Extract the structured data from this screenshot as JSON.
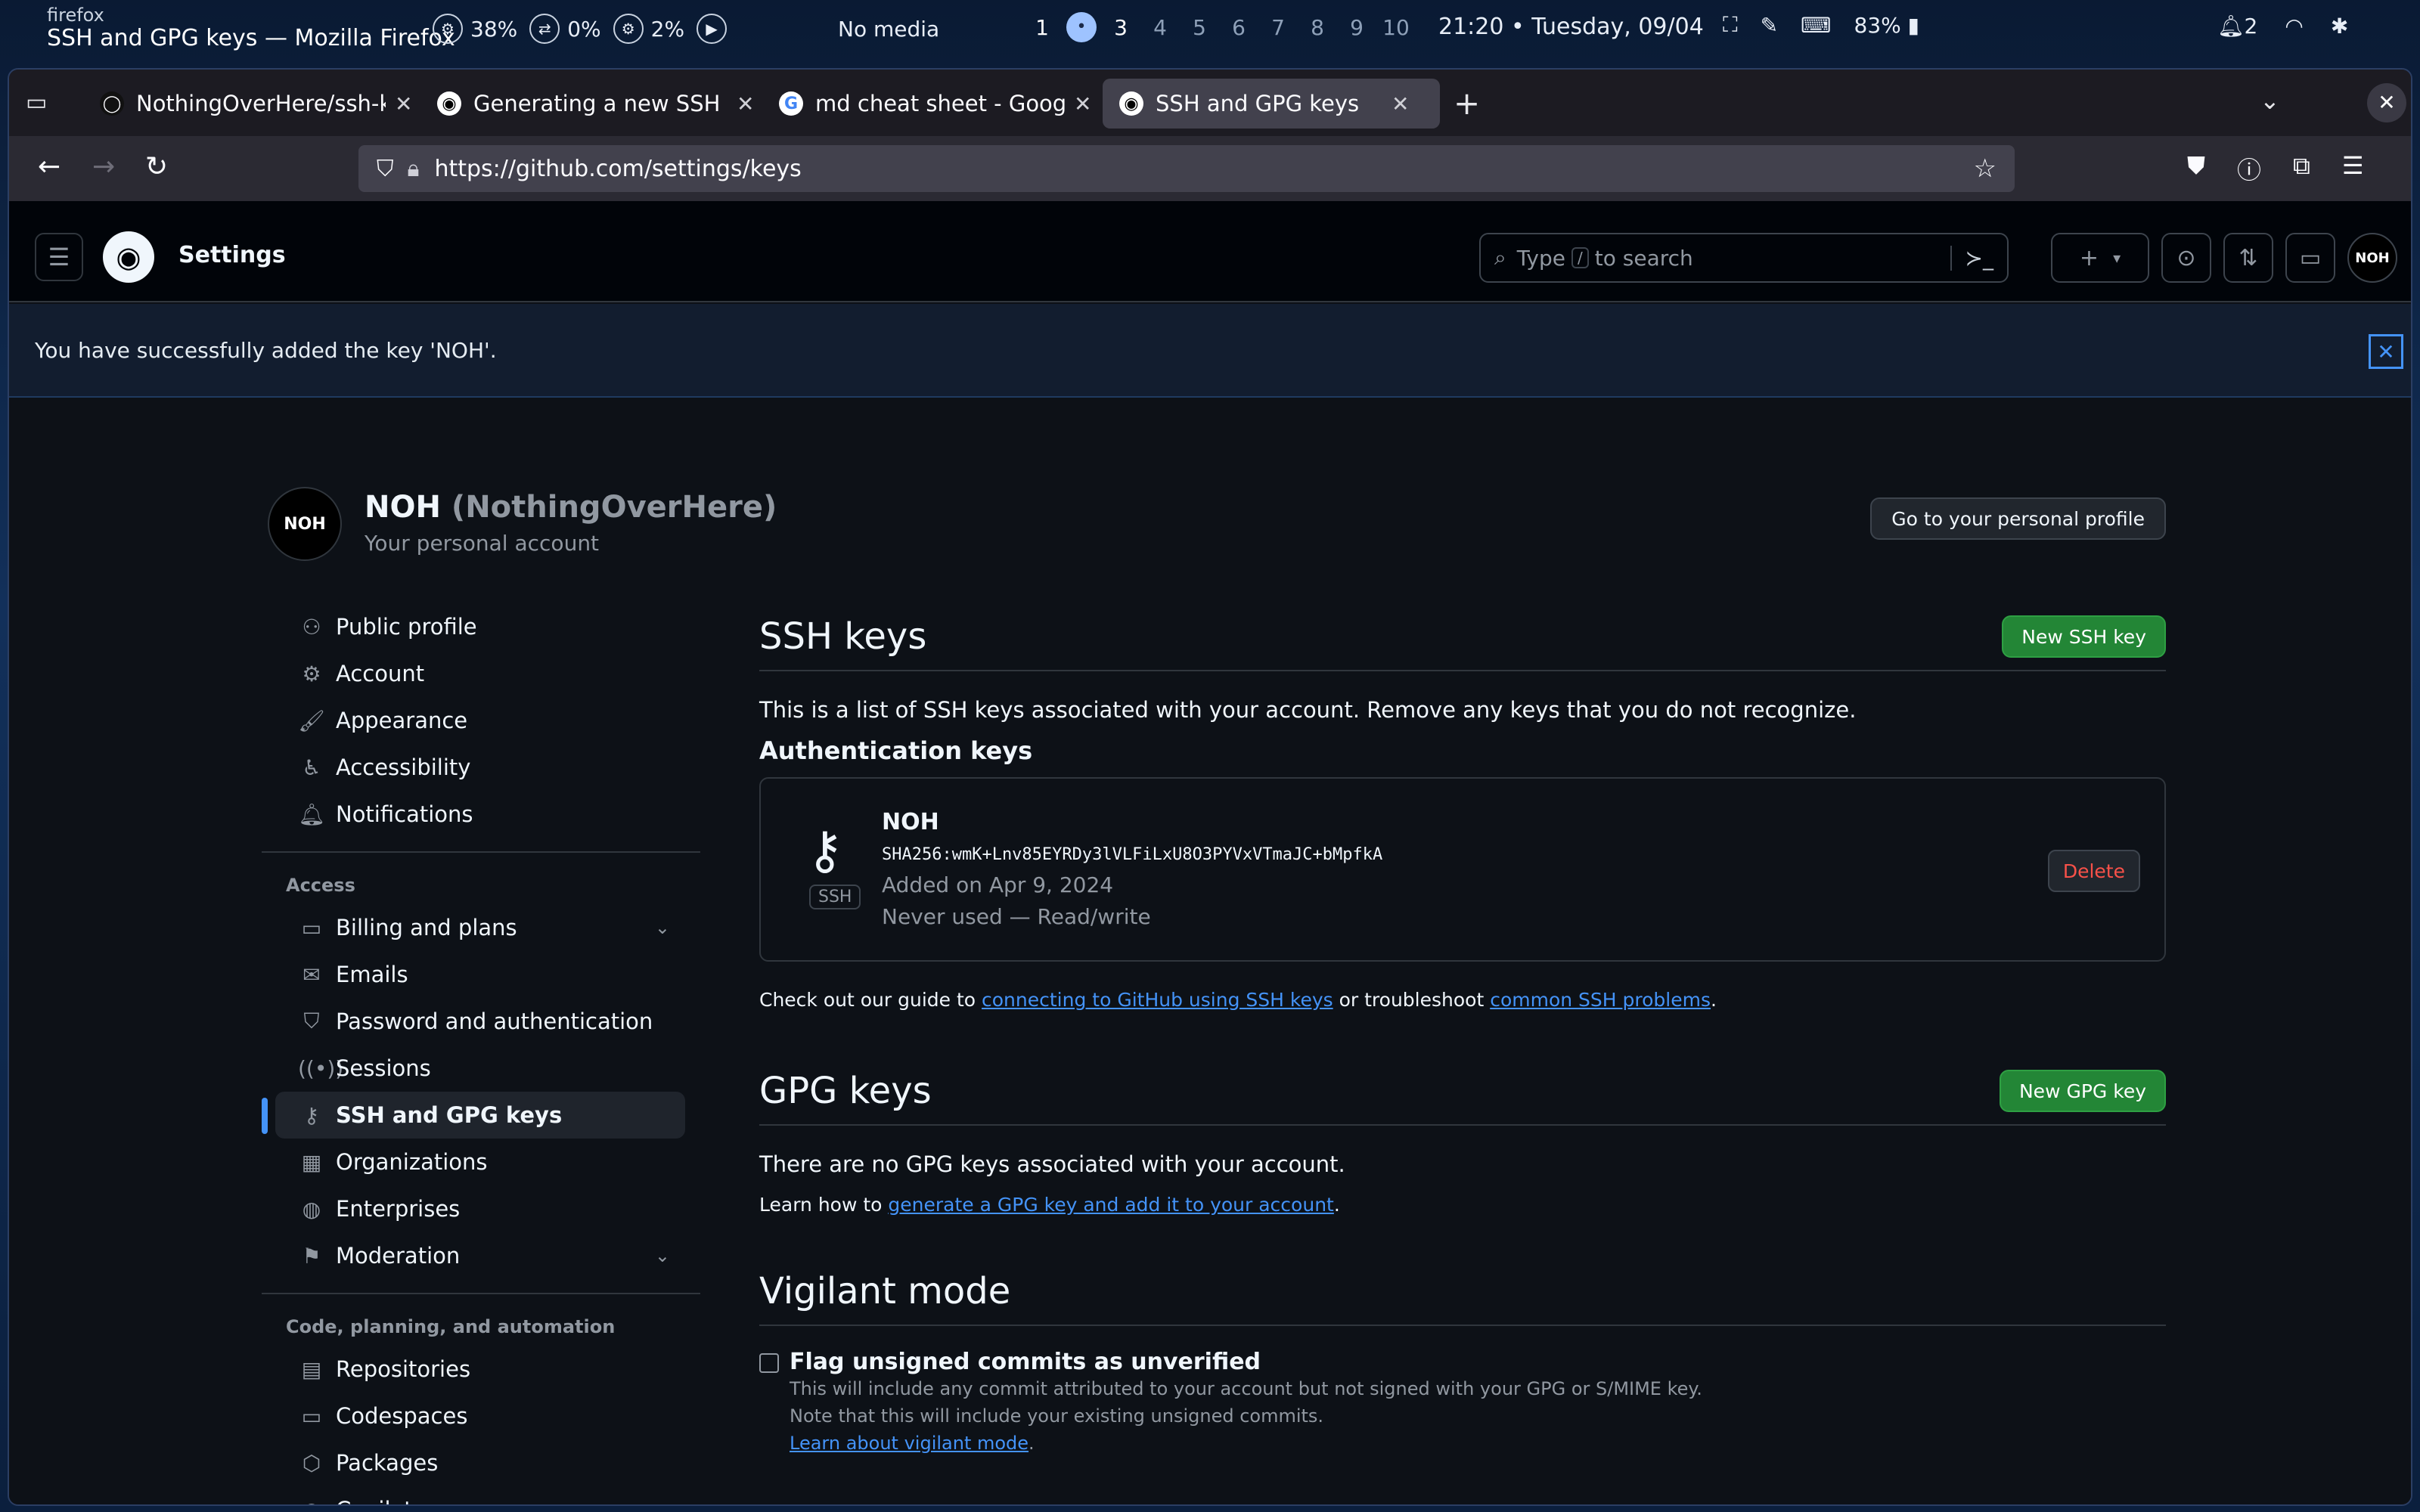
{
  "system": {
    "app_name": "firefox",
    "window_title": "SSH and GPG keys — Mozilla Firefox",
    "stats": [
      {
        "icon": "cpu-icon",
        "value": "38%"
      },
      {
        "icon": "swap-icon",
        "value": "0%"
      },
      {
        "icon": "memory-icon",
        "value": "2%"
      }
    ],
    "media": "No media",
    "workspaces": [
      "1",
      "•",
      "3",
      "4",
      "5",
      "6",
      "7",
      "8",
      "9",
      "10"
    ],
    "active_workspace": 1,
    "clock": "21:20 • Tuesday, 09/04",
    "battery": "83%",
    "notifications": "2"
  },
  "browser": {
    "tabs": [
      {
        "title": "NothingOverHere/ssh-k",
        "favicon": "github-icon",
        "active": false
      },
      {
        "title": "Generating a new SSH k",
        "favicon": "github-icon",
        "active": false
      },
      {
        "title": "md cheat sheet - Google",
        "favicon": "google-icon",
        "active": false
      },
      {
        "title": "SSH and GPG keys",
        "favicon": "github-icon",
        "active": true
      }
    ],
    "url": "https://github.com/settings/keys"
  },
  "github": {
    "context": "Settings",
    "search_placeholder_pre": "Type",
    "search_kbd": "/",
    "search_placeholder_post": "to search",
    "avatar_text": "NOH",
    "flash_message": "You have successfully added the key 'NOH'.",
    "profile": {
      "avatar_text": "NOH",
      "name": "NOH",
      "login": "(NothingOverHere)",
      "subtitle": "Your personal account",
      "profile_button": "Go to your personal profile"
    },
    "sidebar": {
      "items_top": [
        {
          "label": "Public profile",
          "icon": "person-icon"
        },
        {
          "label": "Account",
          "icon": "gear-icon"
        },
        {
          "label": "Appearance",
          "icon": "paintbrush-icon"
        },
        {
          "label": "Accessibility",
          "icon": "accessibility-icon"
        },
        {
          "label": "Notifications",
          "icon": "bell-icon"
        }
      ],
      "access_heading": "Access",
      "items_access": [
        {
          "label": "Billing and plans",
          "icon": "credit-card-icon"
        },
        {
          "label": "Emails",
          "icon": "mail-icon"
        },
        {
          "label": "Password and authentication",
          "icon": "shield-icon"
        },
        {
          "label": "Sessions",
          "icon": "broadcast-icon"
        },
        {
          "label": "SSH and GPG keys",
          "icon": "key-icon"
        },
        {
          "label": "Organizations",
          "icon": "organization-icon"
        },
        {
          "label": "Enterprises",
          "icon": "globe-icon"
        },
        {
          "label": "Moderation",
          "icon": "report-icon"
        }
      ],
      "code_heading": "Code, planning, and automation",
      "items_code": [
        {
          "label": "Repositories",
          "icon": "repo-icon"
        },
        {
          "label": "Codespaces",
          "icon": "codespaces-icon"
        },
        {
          "label": "Packages",
          "icon": "package-icon"
        },
        {
          "label": "Copilot",
          "icon": "copilot-icon"
        }
      ]
    },
    "ssh": {
      "title": "SSH keys",
      "new_button": "New SSH key",
      "description": "This is a list of SSH keys associated with your account. Remove any keys that you do not recognize.",
      "auth_title": "Authentication keys",
      "key": {
        "name": "NOH",
        "type_badge": "SSH",
        "fingerprint": "SHA256:wmK+Lnv85EYRDy3lVLFiLxU8O3PYVxVTmaJC+bMpfkA",
        "added": "Added on Apr 9, 2024",
        "usage": "Never used — Read/write",
        "delete_button": "Delete"
      },
      "guide_pre": "Check out our guide to",
      "guide_link1": "connecting to GitHub using SSH keys",
      "guide_mid": "or troubleshoot",
      "guide_link2": "common SSH problems",
      "guide_end": "."
    },
    "gpg": {
      "title": "GPG keys",
      "new_button": "New GPG key",
      "empty": "There are no GPG keys associated with your account.",
      "learn_pre": "Learn how to",
      "learn_link": "generate a GPG key and add it to your account",
      "learn_end": "."
    },
    "vigilant": {
      "title": "Vigilant mode",
      "checkbox_label": "Flag unsigned commits as unverified",
      "note1": "This will include any commit attributed to your account but not signed with your GPG or S/MIME key.",
      "note2": "Note that this will include your existing unsigned commits.",
      "learn_link": "Learn about vigilant mode",
      "learn_end": "."
    }
  }
}
